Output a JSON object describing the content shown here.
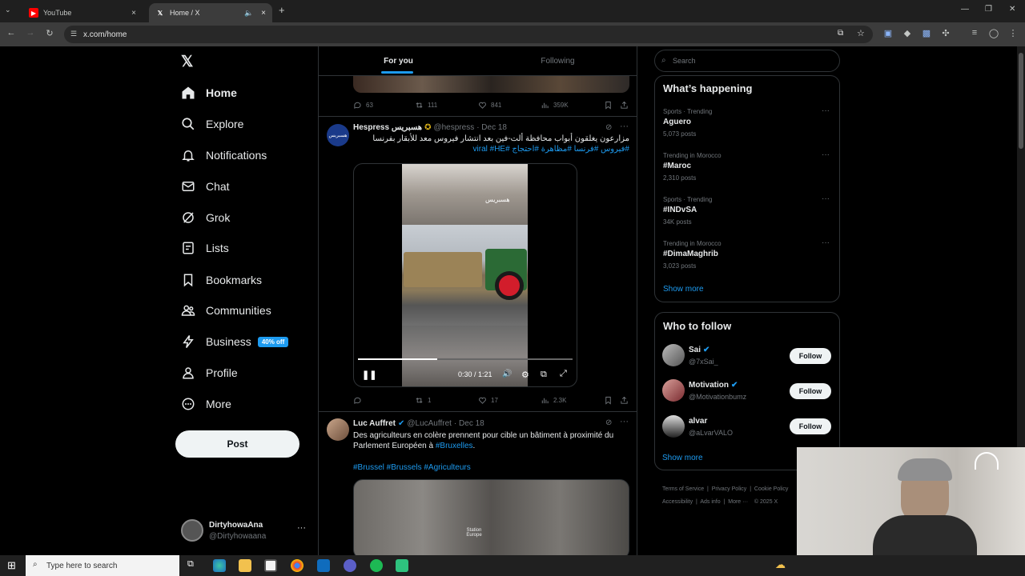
{
  "browser": {
    "tabs": [
      {
        "title": "YouTube",
        "close": "×"
      },
      {
        "title": "Home / X",
        "close": "×"
      }
    ],
    "new_tab": "+",
    "url": "x.com/home",
    "window_controls": [
      "—",
      "❐",
      "✕"
    ]
  },
  "nav": {
    "items": [
      {
        "label": "Home",
        "icon": "home-icon"
      },
      {
        "label": "Explore",
        "icon": "search-icon"
      },
      {
        "label": "Notifications",
        "icon": "bell-icon"
      },
      {
        "label": "Chat",
        "icon": "mail-icon"
      },
      {
        "label": "Grok",
        "icon": "grok-icon"
      },
      {
        "label": "Lists",
        "icon": "list-icon"
      },
      {
        "label": "Bookmarks",
        "icon": "bookmark-icon"
      },
      {
        "label": "Communities",
        "icon": "people-icon"
      },
      {
        "label": "Business",
        "icon": "lightning-icon"
      },
      {
        "label": "Profile",
        "icon": "person-icon"
      },
      {
        "label": "More",
        "icon": "more-circle-icon"
      }
    ],
    "business_badge": "40% off",
    "post_button": "Post",
    "account": {
      "name": "DirtyhowaAna",
      "handle": "@Dirtyhowaana",
      "menu": "···"
    }
  },
  "timeline": {
    "tabs": [
      "For you",
      "Following"
    ],
    "prev_tweet_stats": {
      "replies": "63",
      "reposts": "111",
      "likes": "841",
      "views": "359K"
    },
    "tweet1": {
      "name": "Hespress هسبريس",
      "handle": "@hespress",
      "date": "· Dec 18",
      "text": "مزارعون يغلقون أبواب محافظة ألت-فين بعد انتشار فيروس معد للأبقار بفرنسا",
      "hashtags": "#فيروس #فرنسا #مظاهرة #احتجاج #viral #HE",
      "video_time": "0:30 / 1:21",
      "video_progress": 0.37,
      "stats": {
        "replies": "",
        "reposts": "1",
        "likes": "17",
        "views": "2.3K"
      }
    },
    "tweet2": {
      "name": "Luc Auffret",
      "handle": "@LucAuffret",
      "date": "· Dec 18",
      "text": "Des agriculteurs en colère prennent pour cible un bâtiment à proximité du Parlement Européen à ",
      "text_link": "#Bruxelles",
      "text_end": ".",
      "hashtags": "#Brussel #Brussels #Agriculteurs"
    }
  },
  "right": {
    "search_placeholder": "Search",
    "whats_happening": "What’s happening",
    "trends": [
      {
        "meta": "Sports · Trending",
        "name": "Aguero",
        "posts": "5,073 posts"
      },
      {
        "meta": "Trending in Morocco",
        "name": "#Maroc",
        "posts": "2,310 posts"
      },
      {
        "meta": "Sports · Trending",
        "name": "#INDvSA",
        "posts": "34K posts"
      },
      {
        "meta": "Trending in Morocco",
        "name": "#DimaMaghrib",
        "posts": "3,023 posts"
      }
    ],
    "show_more": "Show more",
    "who_to_follow": "Who to follow",
    "follow_suggestions": [
      {
        "name": "Sai",
        "handle": "@7xSai_",
        "button": "Follow"
      },
      {
        "name": "Motivation",
        "handle": "@Motivationbumz",
        "button": "Follow"
      },
      {
        "name": "alvar",
        "handle": "@aLvarVALO",
        "button": "Follow"
      }
    ],
    "show_more2": "Show more",
    "footer": [
      "Terms of Service",
      "Privacy Policy",
      "Cookie Policy",
      "Accessibility",
      "Ads info",
      "More ···",
      "© 2025 X"
    ]
  },
  "taskbar": {
    "search": "Type here to search"
  }
}
